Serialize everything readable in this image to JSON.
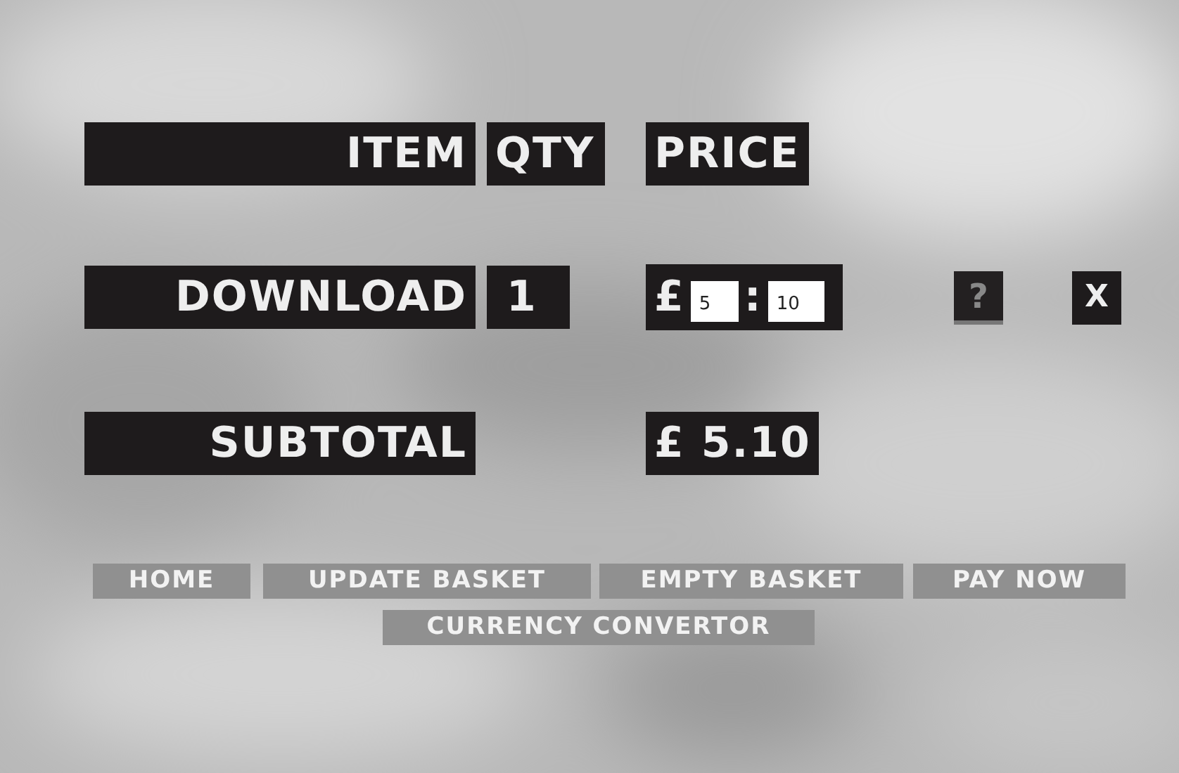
{
  "header": {
    "item": "ITEM",
    "qty": "QTY",
    "price": "PRICE"
  },
  "items": [
    {
      "name": "DOWNLOAD",
      "qty": "1",
      "currency": "£",
      "pounds": "5",
      "separator": ":",
      "pence": "10",
      "help": "?",
      "remove": "X"
    }
  ],
  "subtotal": {
    "label": "SUBTOTAL",
    "value": "£ 5.10"
  },
  "buttons": [
    "HOME",
    "UPDATE BASKET",
    "EMPTY BASKET",
    "PAY NOW"
  ],
  "currency_button": "CURRENCY CONVERTOR"
}
